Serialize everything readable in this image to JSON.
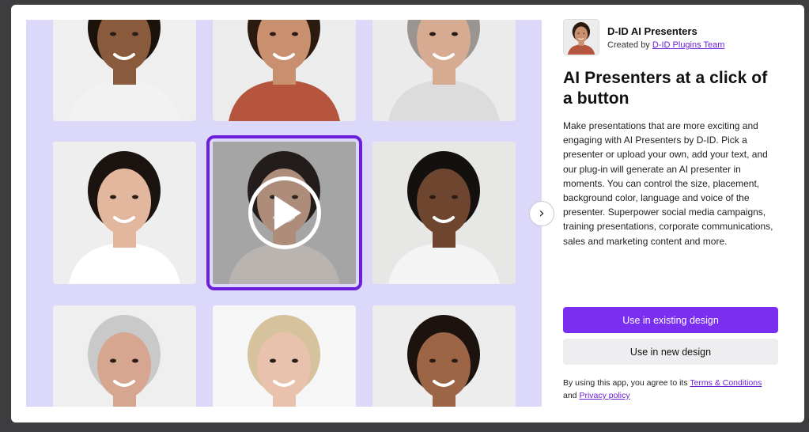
{
  "gallery": {
    "cards": [
      {
        "name": "presenter-woman-curly",
        "skin": "#8a5a3c",
        "hair": "#1c120c",
        "shirt": "#f2f2f2",
        "bg": "#efefef"
      },
      {
        "name": "presenter-man-beard",
        "skin": "#c8906e",
        "hair": "#2a1a10",
        "shirt": "#b5553e",
        "bg": "#ececec"
      },
      {
        "name": "presenter-woman-grey",
        "skin": "#d7aa92",
        "hair": "#9a9590",
        "shirt": "#dcdcdc",
        "bg": "#ebebeb"
      },
      {
        "name": "presenter-woman-bob",
        "skin": "#e2b79e",
        "hair": "#1b130f",
        "shirt": "#ffffff",
        "bg": "#eeeeee"
      },
      {
        "name": "presenter-woman-asian",
        "skin": "#d3a88f",
        "hair": "#1a130f",
        "shirt": "#e3dcd6",
        "bg": "#c8c8c8"
      },
      {
        "name": "presenter-person-glasses",
        "skin": "#6e4630",
        "hair": "#141010",
        "shirt": "#f4f4f4",
        "bg": "#e7e7e5"
      },
      {
        "name": "presenter-man-grey",
        "skin": "#d6a690",
        "hair": "#c9c9c9",
        "shirt": "#2c3b55",
        "bg": "#efefef"
      },
      {
        "name": "presenter-woman-blonde",
        "skin": "#e9c2ad",
        "hair": "#d7c29e",
        "shirt": "#f4efe8",
        "bg": "#f6f6f6"
      },
      {
        "name": "presenter-man-smile",
        "skin": "#9c6646",
        "hair": "#1c130e",
        "shirt": "#2d2d35",
        "bg": "#ededed"
      }
    ]
  },
  "app": {
    "name": "D-ID AI Presenters",
    "created_by_label": "Created by",
    "team": "D-ID Plugins Team",
    "headline": "AI Presenters at a click of a button",
    "description": "Make presentations that are more exciting and engaging with AI Presenters by D-ID. Pick a presenter or upload your own, add your text, and our plug-in will generate an AI presenter in moments. You can control the size, placement, background color, language and voice of the presenter. Superpower social media campaigns, training presentations, corporate communications, sales and marketing content and more."
  },
  "actions": {
    "use_existing": "Use in existing design",
    "use_new": "Use in new design"
  },
  "terms": {
    "prefix": "By using this app, you agree to its",
    "terms_link": "Terms & Conditions",
    "and": "and",
    "privacy_link": "Privacy policy"
  },
  "colors": {
    "accent": "#7a2ff0",
    "gallery_bg": "#dcd8fa",
    "selected_outline": "#6b1fd9"
  }
}
